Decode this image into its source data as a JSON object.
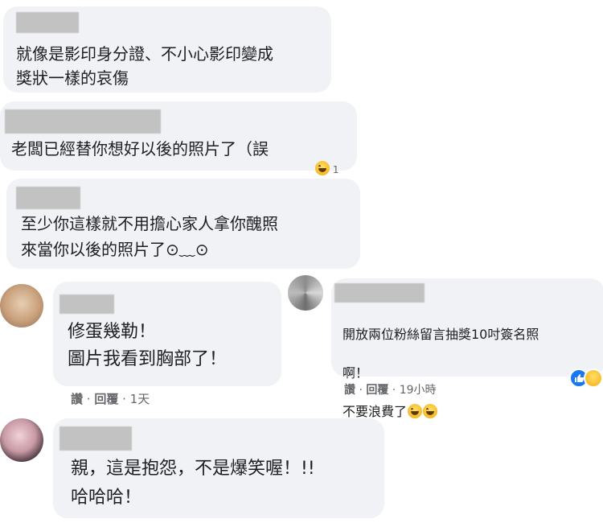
{
  "comments": [
    {
      "text": "就像是影印身分證、不小心影印變成\n獎狀一樣的哀傷"
    },
    {
      "text": "老闆已經替你想好以後的照片了（誤",
      "reaction_count": "1"
    },
    {
      "text": "至少你這樣就不用擔心家人拿你醜照\n來當你以後的照片了⊙﹏⊙"
    },
    {
      "text": "修蛋幾勒！\n圖片我看到胸部了！",
      "like": "讚",
      "reply": "回覆",
      "time": "1天"
    },
    {
      "text_line1": "開放兩位粉絲留言抽獎10吋簽名照",
      "text_line2": "啊！",
      "text_line3": "不要浪費了",
      "like": "讚",
      "reply": "回覆",
      "time": "19小時"
    },
    {
      "text": "親，這是抱怨，不是爆笑喔！!!\n哈哈哈！"
    }
  ],
  "sep": " · ",
  "icons": {
    "laugh": "laughing-emoji-icon",
    "like": "like-reaction-icon",
    "haha": "haha-reaction-icon"
  }
}
